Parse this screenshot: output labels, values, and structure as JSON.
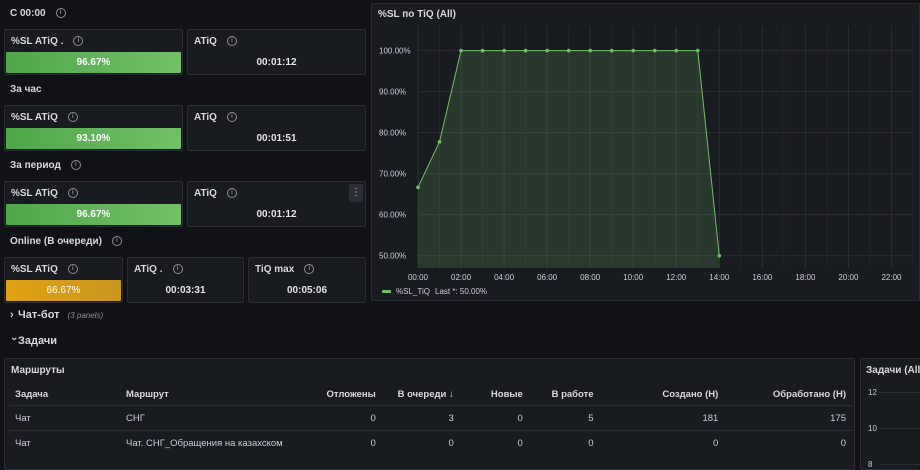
{
  "sections": {
    "since_midnight": {
      "title": "С 00:00",
      "sl_title": "%SL ATiQ .",
      "sl_value": "96.67%",
      "atiq_title": "ATiQ",
      "atiq_value": "00:01:12"
    },
    "last_hour": {
      "title": "За час",
      "sl_title": "%SL ATiQ",
      "sl_value": "93.10%",
      "atiq_title": "ATiQ",
      "atiq_value": "00:01:51"
    },
    "period": {
      "title": "За период",
      "sl_title": "%SL ATiQ",
      "sl_value": "96.67%",
      "atiq_title": "ATiQ",
      "atiq_value": "00:01:12",
      "menu_glyph": "⋮"
    },
    "online": {
      "title": "Online (В очереди)",
      "sl_title": "%SL ATiQ",
      "sl_value": "66.67%",
      "atiq_title": "ATiQ .",
      "atiq_value": "00:03:31",
      "tiq_title": "TiQ max",
      "tiq_value": "00:05:06"
    }
  },
  "colors": {
    "green": "#73bf69",
    "yellow": "#e0a212",
    "background": "#111217",
    "panel": "#181b1f"
  },
  "chart_panel": {
    "title": "%SL по TiQ (All)"
  },
  "chart_data": {
    "type": "area",
    "title": "%SL по TiQ (All)",
    "xlabel": "",
    "ylabel": "",
    "x_ticks": [
      "00:00",
      "02:00",
      "04:00",
      "06:00",
      "08:00",
      "10:00",
      "12:00",
      "14:00",
      "16:00",
      "18:00",
      "20:00",
      "22:00"
    ],
    "y_ticks": [
      "50.00%",
      "60.00%",
      "70.00%",
      "80.00%",
      "90.00%",
      "100.00%"
    ],
    "xlim": [
      0,
      23
    ],
    "ylim": [
      47,
      106
    ],
    "grid": true,
    "legend_position": "bottom-left",
    "series": [
      {
        "name": "%SL_TiQ",
        "color": "#73bf69",
        "x": [
          0,
          1,
          2,
          3,
          4,
          5,
          6,
          7,
          8,
          9,
          10,
          11,
          12,
          13,
          14
        ],
        "y": [
          66.67,
          77.78,
          100,
          100,
          100,
          100,
          100,
          100,
          100,
          100,
          100,
          100,
          100,
          100,
          50
        ]
      }
    ],
    "legend_label": "%SL_TiQ",
    "legend_suffix": "Last *: 50.00%"
  },
  "collapsed_row": {
    "title": "Чат-бот",
    "subtitle": "(3 panels)",
    "chevron": "›"
  },
  "tasks_row": {
    "title": "Задачи",
    "chevron": "›"
  },
  "routes_panel": {
    "title": "Маршруты",
    "sort_icon": "↓",
    "columns": [
      "Задача",
      "Маршрут",
      "Отложены",
      "В очереди",
      "Новые",
      "В работе",
      "Создано (H)",
      "Обработано (H)"
    ],
    "rows": [
      [
        "Чат",
        "СНГ",
        "0",
        "3",
        "0",
        "5",
        "181",
        "175"
      ],
      [
        "Чат",
        "Чат. СНГ_Обращения на казахском",
        "0",
        "0",
        "0",
        "0",
        "0",
        "0"
      ]
    ]
  },
  "side_panel": {
    "title": "Задачи (All)",
    "y_ticks": [
      "12",
      "10",
      "8"
    ]
  }
}
